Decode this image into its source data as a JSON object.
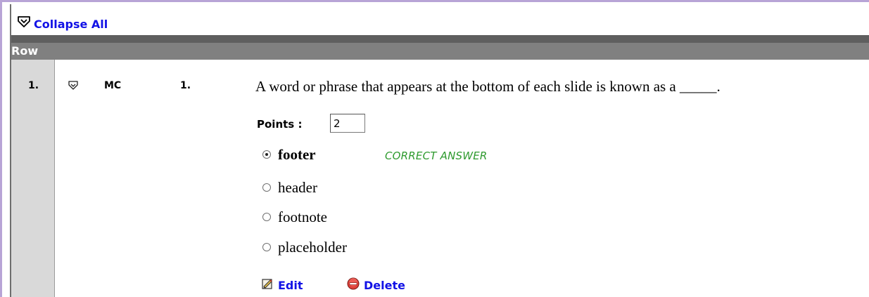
{
  "toolbar": {
    "collapse_all_label": "Collapse All"
  },
  "table": {
    "header_label": "Row"
  },
  "question": {
    "row_number": "1.",
    "type": "MC",
    "number": "1.",
    "text": "A word or phrase that appears at the bottom of each slide is known as a _____.",
    "points_label": "Points :",
    "points_value": "2",
    "choices": [
      {
        "text": "footer",
        "selected": true,
        "correct": true
      },
      {
        "text": "header",
        "selected": false,
        "correct": false
      },
      {
        "text": "footnote",
        "selected": false,
        "correct": false
      },
      {
        "text": "placeholder",
        "selected": false,
        "correct": false
      }
    ],
    "correct_answer_label": "CORRECT ANSWER",
    "edit_label": "Edit",
    "delete_label": "Delete"
  },
  "colors": {
    "link": "#1212e6",
    "header_bg": "#808080",
    "row_col_bg": "#d9d9d9",
    "correct": "#2e9a2e",
    "window_border": "#b8a4d6"
  },
  "icons": {
    "collapse_all": "collapse-all-icon",
    "row_collapse": "row-collapse-icon",
    "edit": "edit-icon",
    "delete": "delete-icon"
  }
}
